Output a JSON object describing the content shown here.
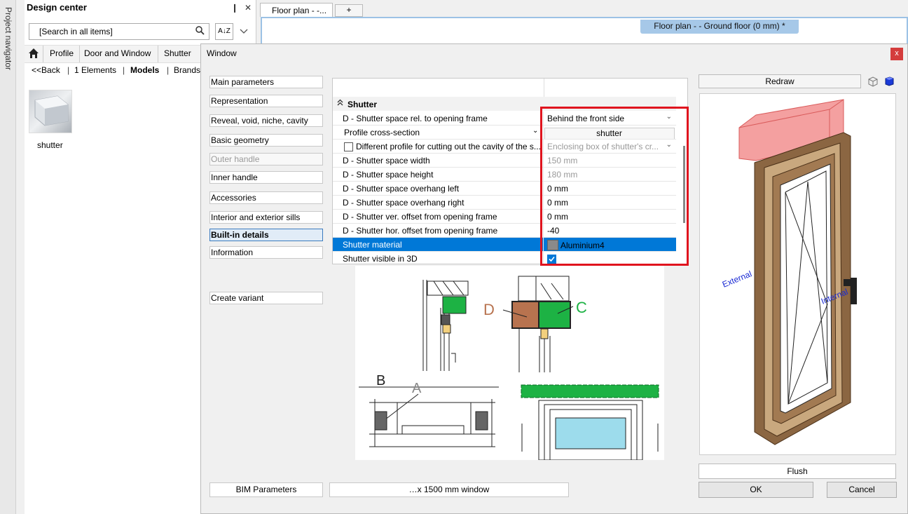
{
  "project_navigator": {
    "label": "Project navigator"
  },
  "design_center": {
    "title": "Design center",
    "pin": "❙",
    "close": "✕",
    "search_placeholder": "[Search in all items]",
    "sort_label": "A↓Z",
    "breadcrumb": [
      "Profile",
      "Door and Window",
      "Shutter"
    ],
    "subnav": {
      "back": "<<Back",
      "elements": "1 Elements",
      "models": "Models",
      "brands": "Brands"
    },
    "item_label": "shutter"
  },
  "tabs": {
    "floor_tab": "Floor plan  -   -...",
    "plus": "+",
    "floor_label": "Floor plan -  - Ground floor (0 mm) *"
  },
  "dialog": {
    "title": "Window",
    "close": "x",
    "nav": [
      "Main parameters",
      "Representation",
      "Reveal, void, niche, cavity",
      "Basic geometry",
      "Outer handle",
      "Inner handle",
      "Accessories",
      "Interior and exterior sills",
      "Built-in details",
      "Information",
      "Create variant"
    ],
    "bim_button": "BIM Parameters",
    "name_field": "…x 1500 mm window"
  },
  "grid": {
    "section": "Shutter",
    "rows": [
      {
        "label": "D - Shutter space rel. to opening frame",
        "value": "Behind the front side"
      },
      {
        "label": "Profile cross-section",
        "value": "shutter"
      },
      {
        "label": "Different profile for cutting out the cavity of the s...",
        "value": "Enclosing box of shutter's cr..."
      },
      {
        "label": "D - Shutter space width",
        "value": "150 mm"
      },
      {
        "label": "D - Shutter space height",
        "value": "180 mm"
      },
      {
        "label": "D - Shutter space overhang left",
        "value": "0 mm"
      },
      {
        "label": "D - Shutter space overhang right",
        "value": "0 mm"
      },
      {
        "label": "D - Shutter ver. offset from opening frame",
        "value": "0 mm"
      },
      {
        "label": "D - Shutter hor. offset from opening frame",
        "value": "-40"
      },
      {
        "label": "Shutter material",
        "value": "Aluminium4"
      },
      {
        "label": "Shutter visible in 3D",
        "value": ""
      }
    ]
  },
  "diagram_labels": {
    "d": "D",
    "c": "C",
    "b": "B",
    "a": "A"
  },
  "preview": {
    "redraw": "Redraw",
    "external": "External",
    "internal": "Internal",
    "flush": "Flush",
    "ok": "OK",
    "cancel": "Cancel"
  },
  "colors": {
    "highlight": "#e0141e",
    "selection": "#0078d7",
    "shutter_box": "#f08080",
    "frame_wood": "#8b6642",
    "diagram_green": "#1db244",
    "diagram_brown": "#b8734f"
  }
}
